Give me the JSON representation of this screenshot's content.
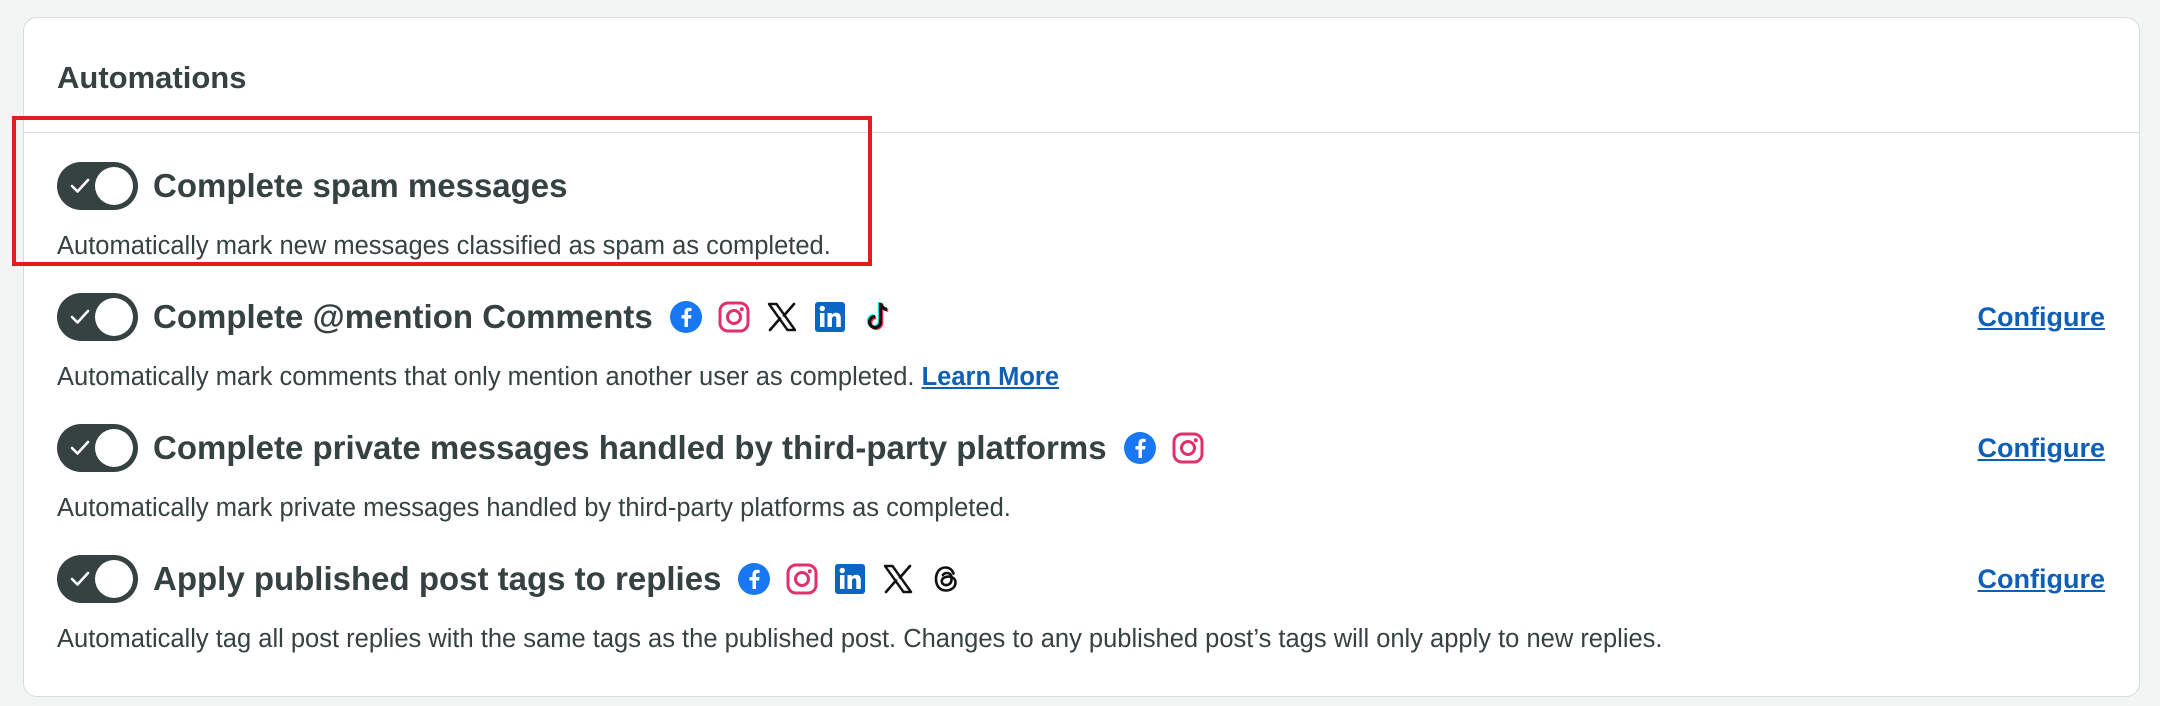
{
  "card": {
    "title": "Automations"
  },
  "colors": {
    "toggle_on": "#364141",
    "link": "#0e5fb5",
    "highlight_border": "#e01e1e"
  },
  "automations": [
    {
      "title": "Complete spam messages",
      "enabled": true,
      "description": "Automatically mark new messages classified as spam as completed.",
      "networks": [],
      "configure_label": "",
      "highlighted": true
    },
    {
      "title": "Complete @mention Comments",
      "enabled": true,
      "description": "Automatically mark comments that only mention another user as completed.",
      "learn_more_label": "Learn More",
      "networks": [
        "facebook-icon",
        "instagram-icon",
        "x-icon",
        "linkedin-icon",
        "tiktok-icon"
      ],
      "configure_label": "Configure"
    },
    {
      "title": "Complete private messages handled by third-party platforms",
      "enabled": true,
      "description": "Automatically mark private messages handled by third-party platforms as completed.",
      "networks": [
        "facebook-icon",
        "instagram-icon"
      ],
      "configure_label": "Configure"
    },
    {
      "title": "Apply published post tags to replies",
      "enabled": true,
      "description": "Automatically tag all post replies with the same tags as the published post. Changes to any published post’s tags will only apply to new replies.",
      "networks": [
        "facebook-icon",
        "instagram-icon",
        "linkedin-icon",
        "x-icon",
        "threads-icon"
      ],
      "configure_label": "Configure"
    }
  ]
}
